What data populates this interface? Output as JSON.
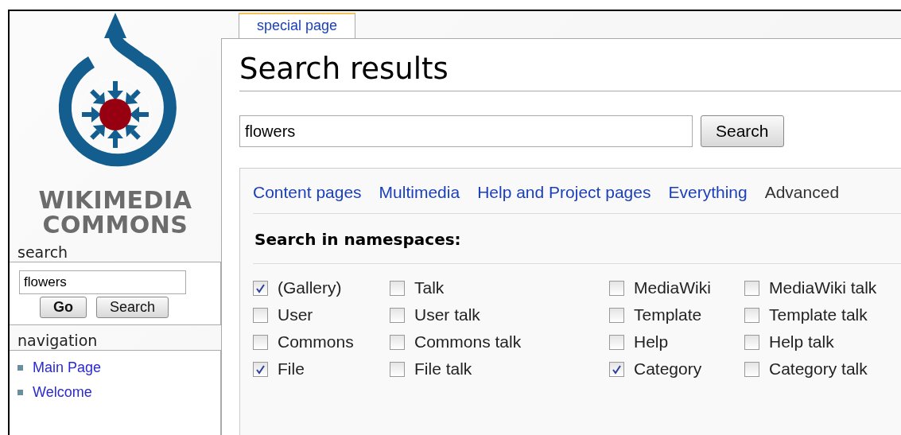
{
  "logo": {
    "line_1": "WIKIMEDIA",
    "line_2": "COMMONS"
  },
  "sidebar": {
    "search": {
      "heading": "search",
      "value": "flowers",
      "buttons": [
        "Go",
        "Search"
      ]
    },
    "navigation": {
      "heading": "navigation",
      "items": [
        "Main Page",
        "Welcome"
      ]
    }
  },
  "tabs": [
    {
      "label": "special page",
      "selected": true
    }
  ],
  "page_title": "Search results",
  "search": {
    "value": "flowers",
    "button": "Search"
  },
  "profiles": [
    {
      "label": "Content pages",
      "selected": false
    },
    {
      "label": "Multimedia",
      "selected": false
    },
    {
      "label": "Help and Project pages",
      "selected": false
    },
    {
      "label": "Everything",
      "selected": false
    },
    {
      "label": "Advanced",
      "selected": true
    }
  ],
  "namespaces": {
    "heading": "Search in namespaces:",
    "items": [
      {
        "label": "(Gallery)",
        "checked": true
      },
      {
        "label": "Talk",
        "checked": false
      },
      {
        "label": "MediaWiki",
        "checked": false
      },
      {
        "label": "MediaWiki talk",
        "checked": false
      },
      {
        "label": "User",
        "checked": false
      },
      {
        "label": "User talk",
        "checked": false
      },
      {
        "label": "Template",
        "checked": false
      },
      {
        "label": "Template talk",
        "checked": false
      },
      {
        "label": "Commons",
        "checked": false
      },
      {
        "label": "Commons talk",
        "checked": false
      },
      {
        "label": "Help",
        "checked": false
      },
      {
        "label": "Help talk",
        "checked": false
      },
      {
        "label": "File",
        "checked": true
      },
      {
        "label": "File talk",
        "checked": false
      },
      {
        "label": "Category",
        "checked": true
      },
      {
        "label": "Category talk",
        "checked": false
      }
    ]
  }
}
